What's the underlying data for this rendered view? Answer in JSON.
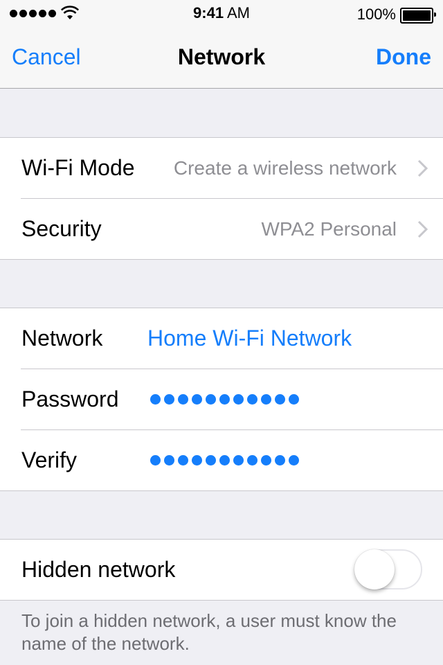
{
  "status_bar": {
    "signal_icon": "signal-dots-icon",
    "wifi_icon": "wifi-icon",
    "time": "9:41",
    "time_suffix": " AM",
    "battery_percent": "100%",
    "battery_icon": "battery-full-icon",
    "battery_level": 1.0
  },
  "nav": {
    "cancel_label": "Cancel",
    "title": "Network",
    "done_label": "Done",
    "accent_color": "#157efb"
  },
  "mode_group": {
    "rows": [
      {
        "label": "Wi-Fi Mode",
        "value": "Create a wireless network",
        "icon": "chevron-right-icon"
      },
      {
        "label": "Security",
        "value": "WPA2 Personal",
        "icon": "chevron-right-icon"
      }
    ]
  },
  "credentials_group": {
    "network_label": "Network",
    "network_value": "Home Wi-Fi Network",
    "password_label": "Password",
    "password_length": 11,
    "verify_label": "Verify",
    "verify_length": 11
  },
  "hidden_group": {
    "label": "Hidden network",
    "toggle_on": false,
    "footer": "To join a hidden network, a user must know the name of the network."
  }
}
